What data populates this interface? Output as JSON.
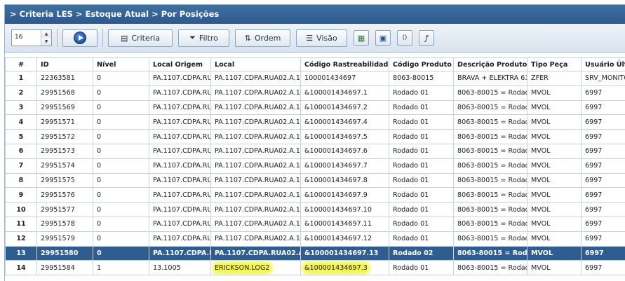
{
  "header": {
    "title": "> Criteria LES > Estoque Atual > Por Posições"
  },
  "toolbar": {
    "page_size": "16",
    "criteria_label": "Criteria",
    "filtro_label": "Filtro",
    "ordem_label": "Ordem",
    "visao_label": "Visão"
  },
  "columns": [
    "#",
    "ID",
    "Nível",
    "Local Origem",
    "Local",
    "Código Rastreabilidade",
    "Código Produto",
    "Descrição Produto",
    "Tipo Peça",
    "Usuário Últim"
  ],
  "rows": [
    [
      "1",
      "22363581",
      "0",
      "PA.1107.CDPA.RU",
      "PA.1107.CDPA.RUA02.A.1.",
      "100001434697",
      "8063-80015",
      "BRAVA + ELEKTRA 63",
      "ZFER",
      "SRV_MONITO"
    ],
    [
      "2",
      "29951568",
      "0",
      "PA.1107.CDPA.RU",
      "PA.1107.CDPA.RUA02.A.1.",
      "&100001434697.1",
      "Rodado 01",
      "8063-80015 = Rodad",
      "MVOL",
      "6997"
    ],
    [
      "3",
      "29951569",
      "0",
      "PA.1107.CDPA.RU",
      "PA.1107.CDPA.RUA02.A.1.",
      "&100001434697.2",
      "Rodado 01",
      "8063-80015 = Rodad",
      "MVOL",
      "6997"
    ],
    [
      "4",
      "29951571",
      "0",
      "PA.1107.CDPA.RU",
      "PA.1107.CDPA.RUA02.A.1.",
      "&100001434697.4",
      "Rodado 01",
      "8063-80015 = Rodad",
      "MVOL",
      "6997"
    ],
    [
      "5",
      "29951572",
      "0",
      "PA.1107.CDPA.RU",
      "PA.1107.CDPA.RUA02.A.1.",
      "&100001434697.5",
      "Rodado 01",
      "8063-80015 = Rodad",
      "MVOL",
      "6997"
    ],
    [
      "6",
      "29951573",
      "0",
      "PA.1107.CDPA.RU",
      "PA.1107.CDPA.RUA02.A.1.",
      "&100001434697.6",
      "Rodado 01",
      "8063-80015 = Rodad",
      "MVOL",
      "6997"
    ],
    [
      "7",
      "29951574",
      "0",
      "PA.1107.CDPA.RU",
      "PA.1107.CDPA.RUA02.A.1.",
      "&100001434697.7",
      "Rodado 01",
      "8063-80015 = Rodad",
      "MVOL",
      "6997"
    ],
    [
      "8",
      "29951575",
      "0",
      "PA.1107.CDPA.RU",
      "PA.1107.CDPA.RUA02.A.1.",
      "&100001434697.8",
      "Rodado 01",
      "8063-80015 = Rodad",
      "MVOL",
      "6997"
    ],
    [
      "9",
      "29951576",
      "0",
      "PA.1107.CDPA.RU",
      "PA.1107.CDPA.RUA02.A.1.",
      "&100001434697.9",
      "Rodado 01",
      "8063-80015 = Rodad",
      "MVOL",
      "6997"
    ],
    [
      "10",
      "29951577",
      "0",
      "PA.1107.CDPA.RU",
      "PA.1107.CDPA.RUA02.A.1.",
      "&100001434697.10",
      "Rodado 01",
      "8063-80015 = Rodad",
      "MVOL",
      "6997"
    ],
    [
      "11",
      "29951578",
      "0",
      "PA.1107.CDPA.RU",
      "PA.1107.CDPA.RUA02.A.1.",
      "&100001434697.11",
      "Rodado 01",
      "8063-80015 = Rodad",
      "MVOL",
      "6997"
    ],
    [
      "12",
      "29951579",
      "0",
      "PA.1107.CDPA.RU",
      "PA.1107.CDPA.RUA02.A.1.",
      "&100001434697.12",
      "Rodado 01",
      "8063-80015 = Rodad",
      "MVOL",
      "6997"
    ],
    [
      "13",
      "29951580",
      "0",
      "PA.1107.CDPA.RU",
      "PA.1107.CDPA.RUA02.A.1.",
      "&100001434697.13",
      "Rodado 02",
      "8063-80015 = Rodad",
      "MVOL",
      "6997"
    ],
    [
      "14",
      "29951584",
      "1",
      "13.1005",
      "ERICKSON.LOG2",
      "&100001434697.3",
      "Rodado 01",
      "8063-80015 = Rodad",
      "MVOL",
      "6997"
    ]
  ],
  "selected_row": 13,
  "highlighted_row": 14,
  "colors": {
    "title_bg": "#2d5a8e",
    "selected_bg": "#2f5d8f",
    "highlight": "#f4f84a"
  }
}
